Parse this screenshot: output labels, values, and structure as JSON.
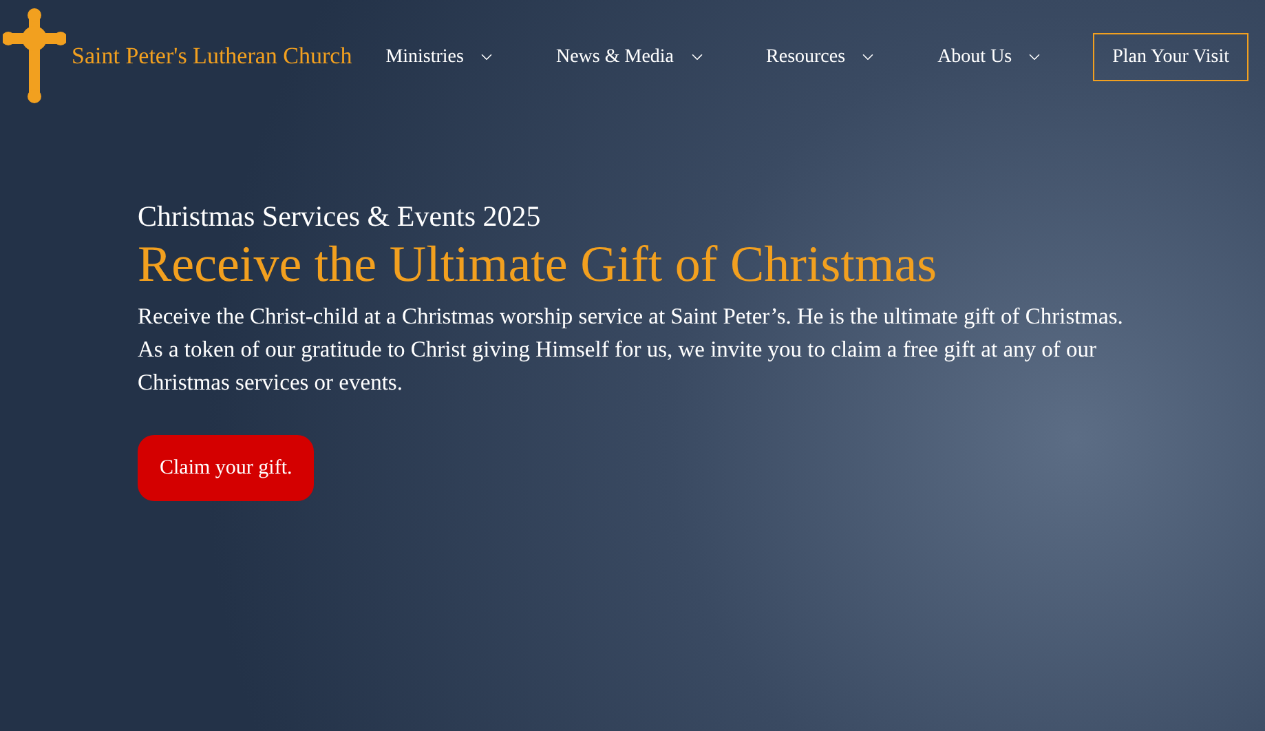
{
  "header": {
    "logo_text": "Saint Peter's Lutheran Church",
    "nav_items": [
      {
        "label": "Ministries",
        "kind": "dropdown"
      },
      {
        "label": "News & Media",
        "kind": "dropdown"
      },
      {
        "label": "Resources",
        "kind": "dropdown"
      },
      {
        "label": "About Us",
        "kind": "dropdown"
      }
    ],
    "cta_button": "Plan Your Visit"
  },
  "hero": {
    "eyebrow": "Christmas Services & Events 2025",
    "heading": "Receive the Ultimate Gift of Christmas",
    "body": "Receive the Christ-child at a Christmas worship service at Saint Peter’s. He is the ultimate gift of Christmas. As a token of our gratitude to Christ giving Himself for us, we invite you to claim a free gift at any of our Christmas services or events.",
    "button": "Claim your gift."
  }
}
